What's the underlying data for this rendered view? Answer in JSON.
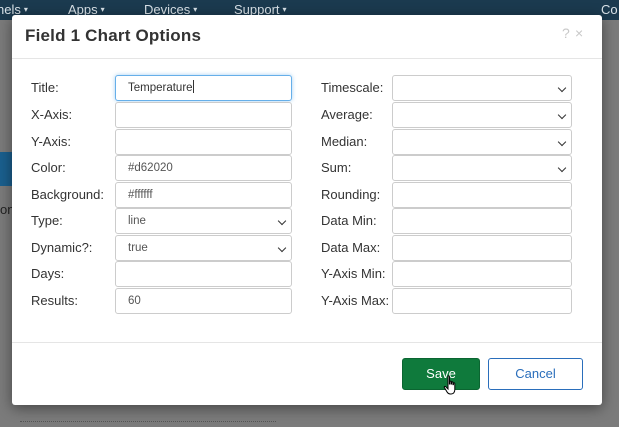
{
  "background": {
    "nav": [
      {
        "label": "nels",
        "caret": "▾"
      },
      {
        "label": "Apps",
        "caret": "▾"
      },
      {
        "label": "Devices",
        "caret": "▾"
      },
      {
        "label": "Support",
        "caret": "▾"
      },
      {
        "label": "Co",
        "caret": ""
      }
    ],
    "side_text": "on"
  },
  "modal": {
    "title": "Field 1 Chart Options",
    "help_glyph": "?",
    "close_glyph": "×"
  },
  "form": {
    "left": [
      {
        "label": "Title:",
        "value": "Temperature",
        "type": "text"
      },
      {
        "label": "X-Axis:",
        "value": "",
        "type": "text"
      },
      {
        "label": "Y-Axis:",
        "value": "",
        "type": "text"
      },
      {
        "label": "Color:",
        "value": "#d62020",
        "type": "text"
      },
      {
        "label": "Background:",
        "value": "#ffffff",
        "type": "text"
      },
      {
        "label": "Type:",
        "value": "line",
        "type": "select"
      },
      {
        "label": "Dynamic?:",
        "value": "true",
        "type": "select"
      },
      {
        "label": "Days:",
        "value": "",
        "type": "text"
      },
      {
        "label": "Results:",
        "value": "60",
        "type": "text"
      }
    ],
    "right": [
      {
        "label": "Timescale:",
        "value": "",
        "type": "select"
      },
      {
        "label": "Average:",
        "value": "",
        "type": "select"
      },
      {
        "label": "Median:",
        "value": "",
        "type": "select"
      },
      {
        "label": "Sum:",
        "value": "",
        "type": "select"
      },
      {
        "label": "Rounding:",
        "value": "",
        "type": "text"
      },
      {
        "label": "Data Min:",
        "value": "",
        "type": "text"
      },
      {
        "label": "Data Max:",
        "value": "",
        "type": "text"
      },
      {
        "label": "Y-Axis Min:",
        "value": "",
        "type": "text"
      },
      {
        "label": "Y-Axis Max:",
        "value": "",
        "type": "text"
      }
    ]
  },
  "footer": {
    "save_label": "Save",
    "cancel_label": "Cancel"
  },
  "colors": {
    "save": "#0f7a3c",
    "cancel": "#2a6ebb",
    "navbar": "#1b3a4f"
  }
}
